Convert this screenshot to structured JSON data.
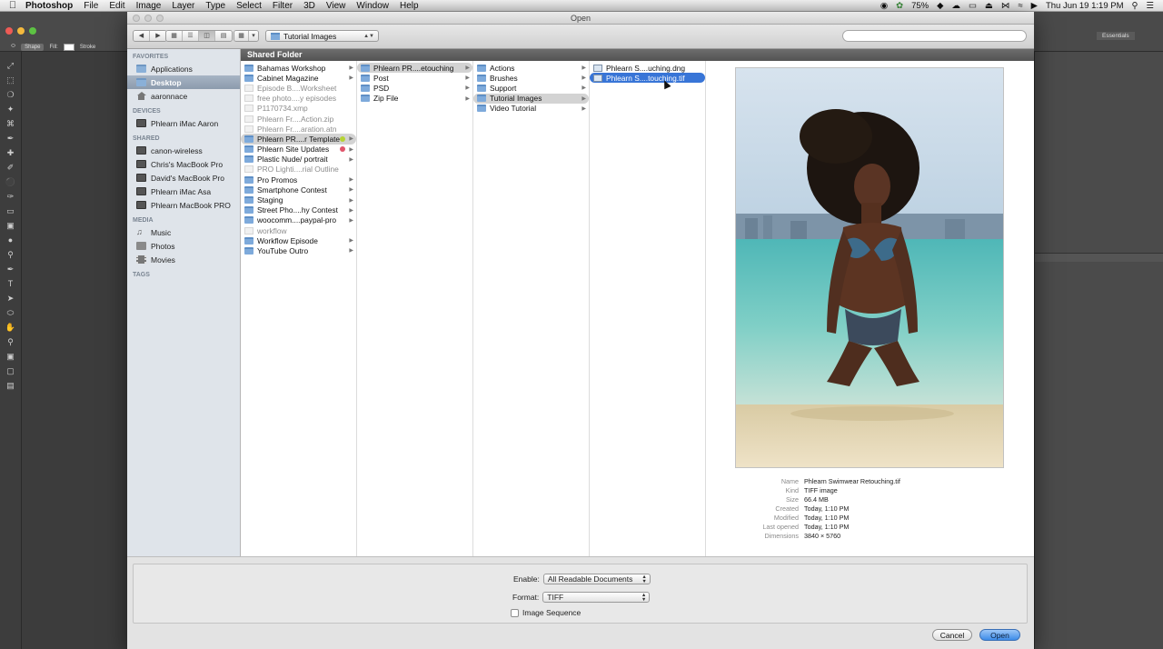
{
  "menubar": {
    "app_name": "Photoshop",
    "menus": [
      "File",
      "Edit",
      "Image",
      "Layer",
      "Type",
      "Select",
      "Filter",
      "3D",
      "View",
      "Window",
      "Help"
    ],
    "battery": "75%",
    "clock": "Thu Jun 19  1:19 PM"
  },
  "photoshop": {
    "options_shape": "Shape",
    "options_fill": "Fill:",
    "options_stroke": "Stroke",
    "workspace": "Essentials"
  },
  "dialog": {
    "title": "Open",
    "path_popup": "Tutorial Images",
    "search_placeholder": "",
    "path_title": "Shared Folder"
  },
  "sidebar": {
    "sections": [
      {
        "heading": "FAVORITES",
        "items": [
          {
            "label": "Applications",
            "icon": "applications-folder-icon"
          },
          {
            "label": "Desktop",
            "icon": "desktop-folder-icon",
            "selected": true
          },
          {
            "label": "aaronnace",
            "icon": "home-icon"
          }
        ]
      },
      {
        "heading": "DEVICES",
        "items": [
          {
            "label": "Phlearn iMac Aaron",
            "icon": "imac-icon"
          }
        ]
      },
      {
        "heading": "SHARED",
        "items": [
          {
            "label": "canon-wireless",
            "icon": "network-computer-icon"
          },
          {
            "label": "Chris's MacBook Pro",
            "icon": "network-computer-icon"
          },
          {
            "label": "David's MacBook Pro",
            "icon": "network-computer-icon"
          },
          {
            "label": "Phlearn iMac Asa",
            "icon": "network-computer-icon"
          },
          {
            "label": "Phlearn MacBook PRO",
            "icon": "network-computer-icon"
          }
        ]
      },
      {
        "heading": "MEDIA",
        "items": [
          {
            "label": "Music",
            "icon": "music-icon"
          },
          {
            "label": "Photos",
            "icon": "photos-icon"
          },
          {
            "label": "Movies",
            "icon": "movies-icon"
          }
        ]
      },
      {
        "heading": "TAGS",
        "items": []
      }
    ]
  },
  "columns": {
    "col1": [
      {
        "label": "Bahamas Workshop",
        "kind": "folder",
        "arrow": true
      },
      {
        "label": "Cabinet Magazine",
        "kind": "folder",
        "arrow": true
      },
      {
        "label": "Episode B....Worksheet",
        "kind": "file",
        "dim": true
      },
      {
        "label": "free photo....y episodes",
        "kind": "file",
        "dim": true
      },
      {
        "label": "P1170734.xmp",
        "kind": "file",
        "dim": true
      },
      {
        "label": "Phlearn Fr....Action.zip",
        "kind": "file",
        "dim": true
      },
      {
        "label": "Phlearn Fr....aration.atn",
        "kind": "file",
        "dim": true
      },
      {
        "label": "Phlearn PR....r Template",
        "kind": "folder",
        "arrow": true,
        "selected": true,
        "tag": "#b5d334"
      },
      {
        "label": "Phlearn Site Updates",
        "kind": "folder",
        "arrow": true,
        "tag": "#e0556b"
      },
      {
        "label": "Plastic Nude/ portrait",
        "kind": "folder",
        "arrow": true
      },
      {
        "label": "PRO Lighti....rial Outline",
        "kind": "file",
        "dim": true
      },
      {
        "label": "Pro Promos",
        "kind": "folder",
        "arrow": true
      },
      {
        "label": "Smartphone Contest",
        "kind": "folder",
        "arrow": true
      },
      {
        "label": "Staging",
        "kind": "folder",
        "arrow": true
      },
      {
        "label": "Street Pho....hy Contest",
        "kind": "folder",
        "arrow": true
      },
      {
        "label": "woocomm....paypal-pro",
        "kind": "folder",
        "arrow": true
      },
      {
        "label": "workflow",
        "kind": "file",
        "dim": true
      },
      {
        "label": "Workflow Episode",
        "kind": "folder",
        "arrow": true
      },
      {
        "label": "YouTube Outro",
        "kind": "folder",
        "arrow": true
      }
    ],
    "col2": [
      {
        "label": "Phlearn PR....etouching",
        "kind": "folder",
        "arrow": true,
        "selected": true
      },
      {
        "label": "Post",
        "kind": "folder",
        "arrow": true
      },
      {
        "label": "PSD",
        "kind": "folder",
        "arrow": true
      },
      {
        "label": "Zip File",
        "kind": "folder",
        "arrow": true
      }
    ],
    "col3": [
      {
        "label": "Actions",
        "kind": "folder",
        "arrow": true
      },
      {
        "label": "Brushes",
        "kind": "folder",
        "arrow": true
      },
      {
        "label": "Support",
        "kind": "folder",
        "arrow": true
      },
      {
        "label": "Tutorial Images",
        "kind": "folder",
        "arrow": true,
        "selected": true
      },
      {
        "label": "Video Tutorial",
        "kind": "folder",
        "arrow": true
      }
    ],
    "col4": [
      {
        "label": "Phlearn S....uching.dng",
        "kind": "img"
      },
      {
        "label": "Phlearn S....touching.tif",
        "kind": "img",
        "active": true
      }
    ]
  },
  "info": [
    {
      "key": "Name",
      "value": "Phlearn Swimwear Retouching.tif"
    },
    {
      "key": "Kind",
      "value": "TIFF image"
    },
    {
      "key": "Size",
      "value": "66.4 MB"
    },
    {
      "key": "Created",
      "value": "Today, 1:10 PM"
    },
    {
      "key": "Modified",
      "value": "Today, 1:10 PM"
    },
    {
      "key": "Last opened",
      "value": "Today, 1:10 PM"
    },
    {
      "key": "Dimensions",
      "value": "3840 × 5760"
    }
  ],
  "options": {
    "enable_label": "Enable:",
    "enable_value": "All Readable Documents",
    "format_label": "Format:",
    "format_value": "TIFF",
    "sequence_label": "Image Sequence",
    "sequence_checked": false
  },
  "buttons": {
    "cancel": "Cancel",
    "open": "Open"
  },
  "colors": {
    "selection_blue": "#3875d7",
    "primary_button": "#3d8ce9"
  }
}
